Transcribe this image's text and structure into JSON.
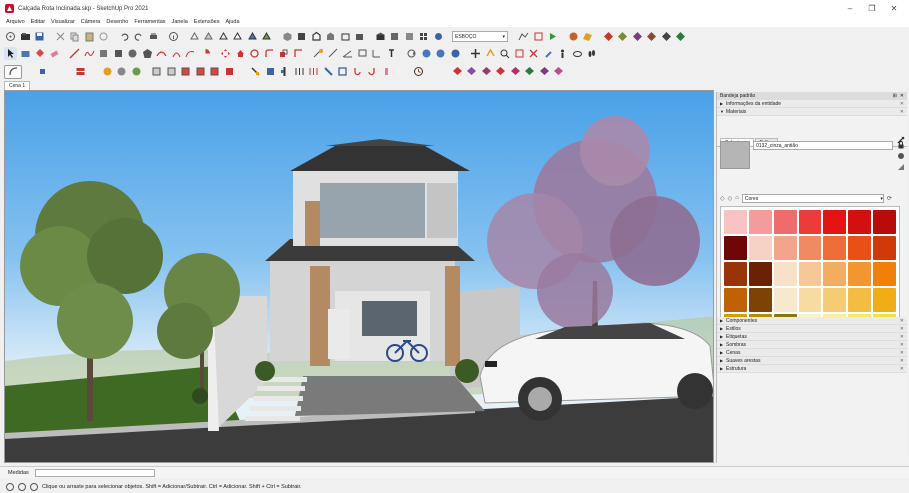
{
  "window": {
    "title": "Calçada Rota Inclinada.skp - SketchUp Pro 2021",
    "min": "–",
    "max": "❐",
    "close": "✕"
  },
  "menu": [
    "Arquivo",
    "Editar",
    "Visualizar",
    "Câmera",
    "Desenho",
    "Ferramentas",
    "Janela",
    "Extensões",
    "Ajuda"
  ],
  "toolbar": {
    "style_select": "ESBOÇO"
  },
  "scene": {
    "tab": "Cena 1"
  },
  "tray": {
    "title": "Bandeja padrão",
    "panels_top": [
      {
        "label": "Informações da entidade",
        "state": "collapsed"
      },
      {
        "label": "Materiais",
        "state": "expanded"
      }
    ],
    "material_name": "0132_cinza_antião",
    "tabs": [
      "Selecionar",
      "Editar"
    ],
    "library": "Cores",
    "panels_bottom": [
      "Componentes",
      "Estilos",
      "Etiquetas",
      "Sombras",
      "Cenas",
      "Suaves arestas",
      "Estrutura"
    ]
  },
  "colors": {
    "grid": [
      "#f7c3c3",
      "#f49b9b",
      "#ef6c6c",
      "#ec3b3b",
      "#e51414",
      "#d30f0f",
      "#b80b0b",
      "#6e0808",
      "#f6d2c6",
      "#f3a48c",
      "#f08a62",
      "#ee6d36",
      "#ea4f16",
      "#cf3a08",
      "#9a3306",
      "#6a2104",
      "#f7e1c8",
      "#f6c797",
      "#f3ad63",
      "#f49630",
      "#f17f08",
      "#c16105",
      "#7d4304",
      "#f7e9cd",
      "#f7dba2",
      "#f5cb73",
      "#f3bc45",
      "#f1ad16",
      "#d39e05",
      "#b28e07",
      "#8a7a06",
      "#f7f2c8",
      "#f5ef9e",
      "#f3ea6c",
      "#f0e43c",
      "#e0ce06",
      "#c7b906",
      "#f5efaa",
      "#f7f3a6",
      "#eff095",
      "#e9ef86",
      "#e2ee70"
    ]
  },
  "measure": {
    "label": "Medidas"
  },
  "status": {
    "text": "Clique ou arraste para selecionar objetos. Shift = Adicionar/Subtrair. Ctrl = Adicionar. Shift + Ctrl = Subtrair."
  }
}
